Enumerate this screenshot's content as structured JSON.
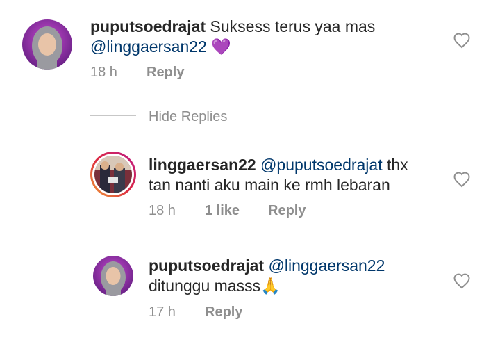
{
  "comments": [
    {
      "username": "puputsoedrajat",
      "text_before": "Suksess terus yaa mas",
      "mention": "@linggaersan22",
      "emoji": "💜",
      "time": "18 h",
      "likes": "",
      "reply_label": "Reply"
    },
    {
      "username": "linggaersan22",
      "mention": "@puputsoedrajat",
      "text_line1_after": "thx",
      "text_line2": "tan nanti aku main ke rmh lebaran",
      "time": "18 h",
      "likes": "1 like",
      "reply_label": "Reply"
    },
    {
      "username": "puputsoedrajat",
      "mention": "@linggaersan22",
      "text_line2": "ditunggu masss",
      "emoji": "🙏",
      "time": "17 h",
      "likes": "",
      "reply_label": "Reply"
    }
  ],
  "hide_replies_label": "Hide Replies",
  "icons": {
    "like": "heart-outline-icon"
  },
  "colors": {
    "text": "#262626",
    "mention": "#00376b",
    "meta": "#8e8e8e",
    "heart_emoji": "#8a3ffc",
    "story_ring": "#d6249f"
  }
}
